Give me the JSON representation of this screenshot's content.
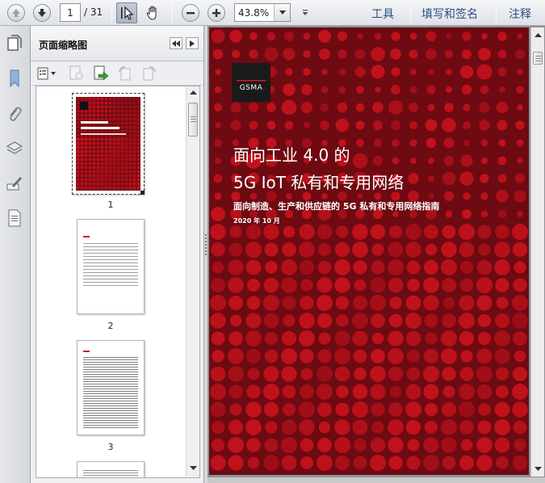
{
  "toolbar": {
    "page_current": "1",
    "page_total": "/ 31",
    "zoom": "43.8%",
    "links": [
      "工具",
      "填写和签名",
      "注释"
    ]
  },
  "icons": {
    "prev_page": "arrow-up-icon",
    "next_page": "arrow-down-icon",
    "select": "cursor-icon",
    "hand": "hand-icon",
    "zoom_out": "minus-icon",
    "zoom_in": "plus-icon"
  },
  "panel": {
    "title": "页面缩略图",
    "thumbnails": [
      {
        "label": "1",
        "selected": true
      },
      {
        "label": "2",
        "selected": false
      },
      {
        "label": "3",
        "selected": false
      }
    ]
  },
  "cover": {
    "logo_text": "GSMA",
    "title_line1": "面向工业 4.0 的",
    "title_line2": "5G IoT 私有和专用网络",
    "subtitle": "面向制造、生产和供应链的 5G 私有和专用网络指南",
    "date": "2020 年 10 月"
  },
  "colors": {
    "link": "#2c4f86",
    "cover_bg": "#6e0a12",
    "cover_dot": "#c1121c",
    "logo_bg": "#1a1a1a"
  }
}
